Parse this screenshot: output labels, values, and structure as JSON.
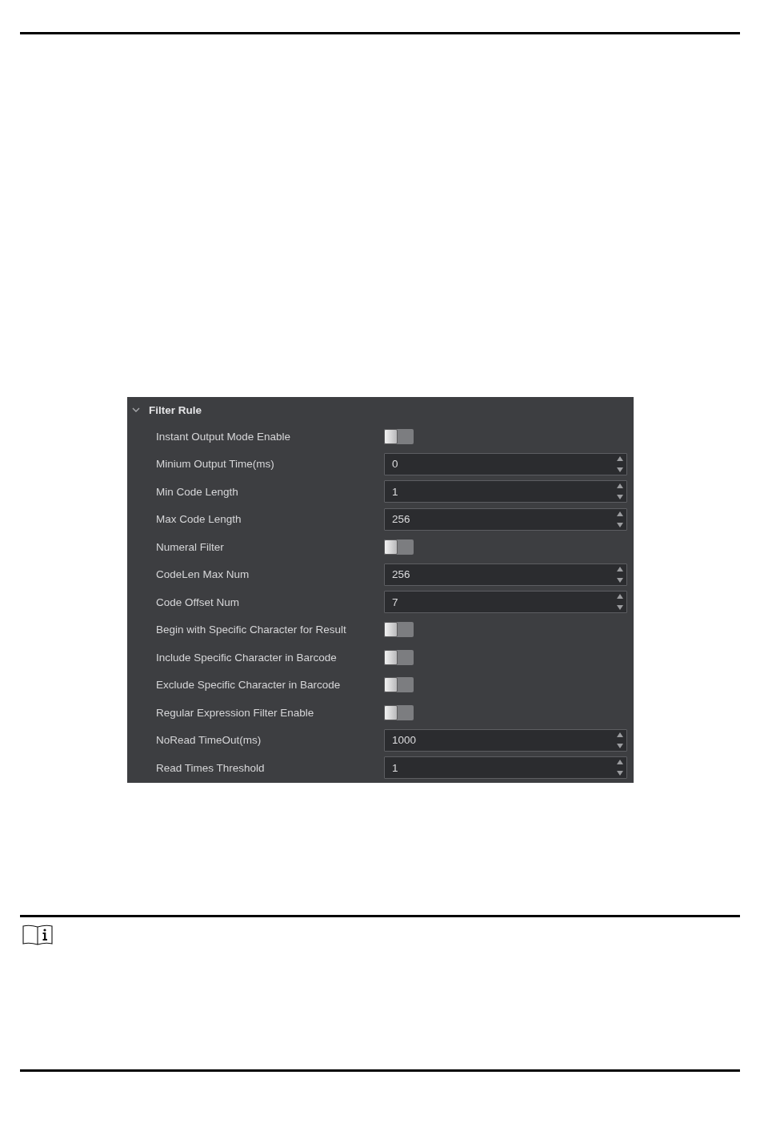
{
  "section": {
    "title": "Filter Rule",
    "expanded": true,
    "rows": [
      {
        "kind": "toggle",
        "label": "Instant Output Mode Enable",
        "on": false
      },
      {
        "kind": "spin",
        "label": "Minium Output Time(ms)",
        "value": "0"
      },
      {
        "kind": "spin",
        "label": "Min Code Length",
        "value": "1"
      },
      {
        "kind": "spin",
        "label": "Max Code Length",
        "value": "256"
      },
      {
        "kind": "toggle",
        "label": "Numeral Filter",
        "on": false
      },
      {
        "kind": "spin",
        "label": "CodeLen Max Num",
        "value": "256"
      },
      {
        "kind": "spin",
        "label": "Code Offset Num",
        "value": "7"
      },
      {
        "kind": "toggle",
        "label": "Begin with Specific Character for Result",
        "on": false
      },
      {
        "kind": "toggle",
        "label": "Include Specific Character in Barcode",
        "on": false
      },
      {
        "kind": "toggle",
        "label": "Exclude Specific Character in Barcode",
        "on": false
      },
      {
        "kind": "toggle",
        "label": "Regular Expression Filter Enable",
        "on": false
      },
      {
        "kind": "spin",
        "label": "NoRead TimeOut(ms)",
        "value": "1000"
      },
      {
        "kind": "spin",
        "label": "Read Times Threshold",
        "value": "1"
      }
    ]
  }
}
